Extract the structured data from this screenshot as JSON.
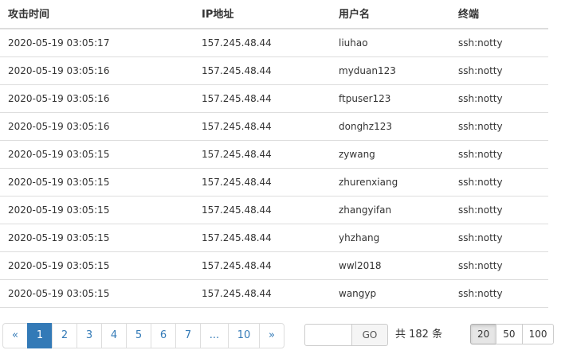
{
  "table": {
    "headers": [
      "攻击时间",
      "IP地址",
      "用户名",
      "终端"
    ],
    "rows": [
      [
        "2020-05-19 03:05:17",
        "157.245.48.44",
        "liuhao",
        "ssh:notty"
      ],
      [
        "2020-05-19 03:05:16",
        "157.245.48.44",
        "myduan123",
        "ssh:notty"
      ],
      [
        "2020-05-19 03:05:16",
        "157.245.48.44",
        "ftpuser123",
        "ssh:notty"
      ],
      [
        "2020-05-19 03:05:16",
        "157.245.48.44",
        "donghz123",
        "ssh:notty"
      ],
      [
        "2020-05-19 03:05:15",
        "157.245.48.44",
        "zywang",
        "ssh:notty"
      ],
      [
        "2020-05-19 03:05:15",
        "157.245.48.44",
        "zhurenxiang",
        "ssh:notty"
      ],
      [
        "2020-05-19 03:05:15",
        "157.245.48.44",
        "zhangyifan",
        "ssh:notty"
      ],
      [
        "2020-05-19 03:05:15",
        "157.245.48.44",
        "yhzhang",
        "ssh:notty"
      ],
      [
        "2020-05-19 03:05:15",
        "157.245.48.44",
        "wwl2018",
        "ssh:notty"
      ],
      [
        "2020-05-19 03:05:15",
        "157.245.48.44",
        "wangyp",
        "ssh:notty"
      ]
    ]
  },
  "pagination": {
    "prev": "«",
    "pages": [
      "1",
      "2",
      "3",
      "4",
      "5",
      "6",
      "7",
      "...",
      "10"
    ],
    "next": "»",
    "current": "1"
  },
  "goto": {
    "value": "",
    "button": "GO"
  },
  "total_text": "共 182 条",
  "page_sizes": [
    "20",
    "50",
    "100"
  ],
  "page_size_selected": "20",
  "colors": {
    "accent": "#337ab7",
    "border": "#dddddd"
  }
}
